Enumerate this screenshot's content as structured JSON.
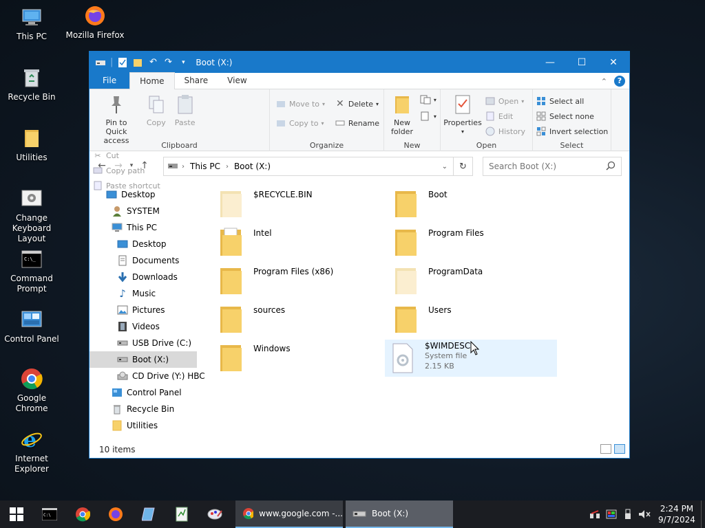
{
  "desktop": {
    "icons": [
      {
        "label": "This PC",
        "icon": "computer-icon"
      },
      {
        "label": "Mozilla Firefox",
        "icon": "firefox-icon"
      },
      {
        "label": "Recycle Bin",
        "icon": "recycle-bin-icon"
      },
      {
        "label": "Utilities",
        "icon": "folder-icon"
      },
      {
        "label": "Change Keyboard Layout",
        "icon": "keyboard-layout-icon"
      },
      {
        "label": "Command Prompt",
        "icon": "cmd-icon"
      },
      {
        "label": "Control Panel",
        "icon": "control-panel-icon"
      },
      {
        "label": "Google Chrome",
        "icon": "chrome-icon"
      },
      {
        "label": "Internet Explorer",
        "icon": "ie-icon"
      }
    ]
  },
  "window": {
    "title": "Boot (X:)",
    "tabs": {
      "file": "File",
      "home": "Home",
      "share": "Share",
      "view": "View"
    },
    "ribbon": {
      "clipboard": {
        "name": "Clipboard",
        "pin": "Pin to Quick access",
        "copy": "Copy",
        "paste": "Paste",
        "cut": "Cut",
        "copy_path": "Copy path",
        "paste_shortcut": "Paste shortcut"
      },
      "organize": {
        "name": "Organize",
        "move_to": "Move to",
        "copy_to": "Copy to",
        "delete": "Delete",
        "rename": "Rename"
      },
      "new": {
        "name": "New",
        "new_folder": "New folder"
      },
      "open": {
        "name": "Open",
        "properties": "Properties",
        "open": "Open",
        "edit": "Edit",
        "history": "History"
      },
      "select": {
        "name": "Select",
        "select_all": "Select all",
        "select_none": "Select none",
        "invert": "Invert selection"
      }
    },
    "address": {
      "this_pc": "This PC",
      "current": "Boot (X:)"
    },
    "search": {
      "placeholder": "Search Boot (X:)"
    },
    "nav": [
      {
        "label": "Desktop",
        "icon": "desktop-icon"
      },
      {
        "label": "SYSTEM",
        "icon": "user-icon"
      },
      {
        "label": "This PC",
        "icon": "computer-icon"
      },
      {
        "label": "Desktop",
        "icon": "desktop-icon"
      },
      {
        "label": "Documents",
        "icon": "documents-icon"
      },
      {
        "label": "Downloads",
        "icon": "download-icon"
      },
      {
        "label": "Music",
        "icon": "music-icon"
      },
      {
        "label": "Pictures",
        "icon": "pictures-icon"
      },
      {
        "label": "Videos",
        "icon": "videos-icon"
      },
      {
        "label": "USB Drive (C:)",
        "icon": "drive-icon"
      },
      {
        "label": "Boot (X:)",
        "icon": "drive-icon"
      },
      {
        "label": "CD Drive (Y:) HBC",
        "icon": "cd-drive-icon"
      },
      {
        "label": "Control Panel",
        "icon": "control-panel-icon"
      },
      {
        "label": "Recycle Bin",
        "icon": "recycle-bin-icon"
      },
      {
        "label": "Utilities",
        "icon": "folder-icon"
      }
    ],
    "files": [
      {
        "name": "$RECYCLE.BIN",
        "type": "folder-faded"
      },
      {
        "name": "Boot",
        "type": "folder"
      },
      {
        "name": "Intel",
        "type": "folder-docs"
      },
      {
        "name": "Program Files",
        "type": "folder"
      },
      {
        "name": "Program Files (x86)",
        "type": "folder"
      },
      {
        "name": "ProgramData",
        "type": "folder-faded"
      },
      {
        "name": "sources",
        "type": "folder"
      },
      {
        "name": "Users",
        "type": "folder"
      },
      {
        "name": "Windows",
        "type": "folder"
      },
      {
        "name": "$WIMDESC",
        "type": "system-file",
        "kind": "System file",
        "size": "2.15 KB"
      }
    ],
    "status": "10 items"
  },
  "taskbar": {
    "tasks": [
      {
        "label": "www.google.com -...",
        "icon": "chrome-icon"
      },
      {
        "label": "Boot (X:)",
        "icon": "drive-icon"
      }
    ],
    "time": "2:24 PM",
    "date": "9/7/2024"
  },
  "colors": {
    "accent": "#1979ca",
    "folder": "#f7d16a",
    "folder_dark": "#e8b84a",
    "taskbar": "#1b1d22"
  }
}
